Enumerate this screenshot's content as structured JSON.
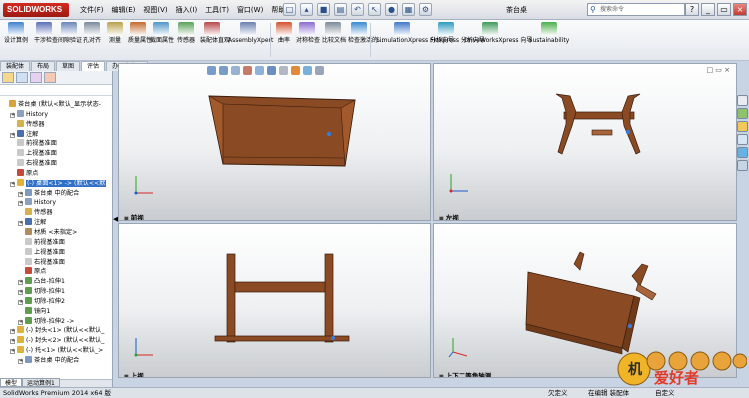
{
  "app": {
    "logo_text": "SOLIDWORKS",
    "document_title": "茶台桌"
  },
  "menu": [
    "文件(F)",
    "编辑(E)",
    "视图(V)",
    "插入(I)",
    "工具(T)",
    "窗口(W)",
    "帮助(H)"
  ],
  "search": {
    "placeholder": "搜索命令"
  },
  "ribbon": [
    {
      "label": "设计算例",
      "color": "#3d7fcc"
    },
    {
      "label": "干涉检查",
      "color": "#5b6fb8"
    },
    {
      "label": "间隙验证",
      "color": "#6a85b6"
    },
    {
      "label": "孔对齐",
      "color": "#7a8a99"
    },
    {
      "label": "测量",
      "color": "#b8a04a"
    },
    {
      "label": "质量属性",
      "color": "#c46a2a"
    },
    {
      "label": "截面属性",
      "color": "#4f95c9"
    },
    {
      "label": "传感器",
      "color": "#58a058"
    },
    {
      "label": "装配体直观",
      "color": "#b5484a"
    },
    {
      "label": "AssemblyXpert",
      "color": "#6b7fae"
    },
    {
      "label": "曲率",
      "color": "#d2502e"
    },
    {
      "label": "对称检查",
      "color": "#8a6ad0"
    },
    {
      "label": "比较文档",
      "color": "#7b8996"
    },
    {
      "label": "检查激活的...",
      "color": "#3a8ad0"
    },
    {
      "label": "SimulationXpress 分析向导",
      "color": "#3f78c8"
    },
    {
      "label": "FloXpress 分析向导",
      "color": "#2f9ac0"
    },
    {
      "label": "DriveWorksXpress 向导",
      "color": "#3f9a5a"
    },
    {
      "label": "Sustainability",
      "color": "#4bae4b"
    }
  ],
  "cm_tabs": [
    "装配体",
    "布局",
    "草图",
    "评估",
    "办公室产品"
  ],
  "cm_active_tab": 3,
  "tree": [
    {
      "label": "茶台桌 (默认<默认_显示状态-",
      "indent": 0,
      "icon": "assembly-icon",
      "color": "#d9a33a",
      "toggle": false
    },
    {
      "label": "History",
      "indent": 1,
      "icon": "history-icon",
      "color": "#8aa0c0",
      "toggle": true
    },
    {
      "label": "传感器",
      "indent": 1,
      "icon": "sensor-icon",
      "color": "#d7b24c",
      "toggle": false
    },
    {
      "label": "注解",
      "indent": 1,
      "icon": "annotation-icon",
      "color": "#4a6fb0",
      "toggle": true
    },
    {
      "label": "前视基准面",
      "indent": 1,
      "icon": "plane-icon",
      "color": "#c9c9c9",
      "toggle": false
    },
    {
      "label": "上视基准面",
      "indent": 1,
      "icon": "plane-icon",
      "color": "#c9c9c9",
      "toggle": false
    },
    {
      "label": "右视基准面",
      "indent": 1,
      "icon": "plane-icon",
      "color": "#c9c9c9",
      "toggle": false
    },
    {
      "label": "原点",
      "indent": 1,
      "icon": "origin-icon",
      "color": "#c54a3a",
      "toggle": false
    },
    {
      "label": "(-) 桌面<1> -> (默认<<默",
      "indent": 1,
      "icon": "part-icon",
      "color": "#e0b23a",
      "toggle": true,
      "selected": true
    },
    {
      "label": "茶台桌 中的配合",
      "indent": 2,
      "icon": "mates-icon",
      "color": "#7f9ac2",
      "toggle": true
    },
    {
      "label": "History",
      "indent": 2,
      "icon": "history-icon",
      "color": "#8aa0c0",
      "toggle": true
    },
    {
      "label": "传感器",
      "indent": 2,
      "icon": "sensor-icon",
      "color": "#d7b24c",
      "toggle": false
    },
    {
      "label": "注解",
      "indent": 2,
      "icon": "annotation-icon",
      "color": "#4a6fb0",
      "toggle": true
    },
    {
      "label": "材质 <未指定>",
      "indent": 2,
      "icon": "material-icon",
      "color": "#b08c5a",
      "toggle": false
    },
    {
      "label": "前视基准面",
      "indent": 2,
      "icon": "plane-icon",
      "color": "#c9c9c9",
      "toggle": false
    },
    {
      "label": "上视基准面",
      "indent": 2,
      "icon": "plane-icon",
      "color": "#c9c9c9",
      "toggle": false
    },
    {
      "label": "右视基准面",
      "indent": 2,
      "icon": "plane-icon",
      "color": "#c9c9c9",
      "toggle": false
    },
    {
      "label": "原点",
      "indent": 2,
      "icon": "origin-icon",
      "color": "#c54a3a",
      "toggle": false
    },
    {
      "label": "凸台-拉伸1",
      "indent": 2,
      "icon": "extrude-icon",
      "color": "#5f9e4f",
      "toggle": true
    },
    {
      "label": "切除-拉伸1",
      "indent": 2,
      "icon": "cut-icon",
      "color": "#5f9e4f",
      "toggle": true
    },
    {
      "label": "切除-拉伸2",
      "indent": 2,
      "icon": "cut-icon",
      "color": "#5f9e4f",
      "toggle": true
    },
    {
      "label": "镜向1",
      "indent": 2,
      "icon": "mirror-icon",
      "color": "#5f9e4f",
      "toggle": false
    },
    {
      "label": "切除-拉伸2 ->",
      "indent": 2,
      "icon": "cut-icon",
      "color": "#5f9e4f",
      "toggle": true
    },
    {
      "label": "(-) 封头<1> (默认<<默认_",
      "indent": 1,
      "icon": "part-icon",
      "color": "#e0b23a",
      "toggle": true
    },
    {
      "label": "(-) 封头<2> (默认<<默认_",
      "indent": 1,
      "icon": "part-icon",
      "color": "#e0b23a",
      "toggle": true
    },
    {
      "label": "(-) 托<1> (默认<<默认_>",
      "indent": 1,
      "icon": "part-icon",
      "color": "#e0b23a",
      "toggle": true
    },
    {
      "label": "茶台桌 中的配合",
      "indent": 2,
      "icon": "mates-icon",
      "color": "#7f9ac2",
      "toggle": true
    }
  ],
  "viewports": [
    {
      "label": "前视"
    },
    {
      "label": "左视"
    },
    {
      "label": "上视"
    },
    {
      "label": "上下二等角轴测"
    }
  ],
  "bottom_tabs": [
    "模型",
    "运动算例1"
  ],
  "status": {
    "product": "SolidWorks Premium 2014 x64 版",
    "definition": "欠定义",
    "editing": "在编辑 装配体",
    "custom": "自定义"
  },
  "watermark_text": "爱好者",
  "colors": {
    "wood": "#8a4a24",
    "wood_light": "#a8643a",
    "selection": "#3170c7"
  }
}
